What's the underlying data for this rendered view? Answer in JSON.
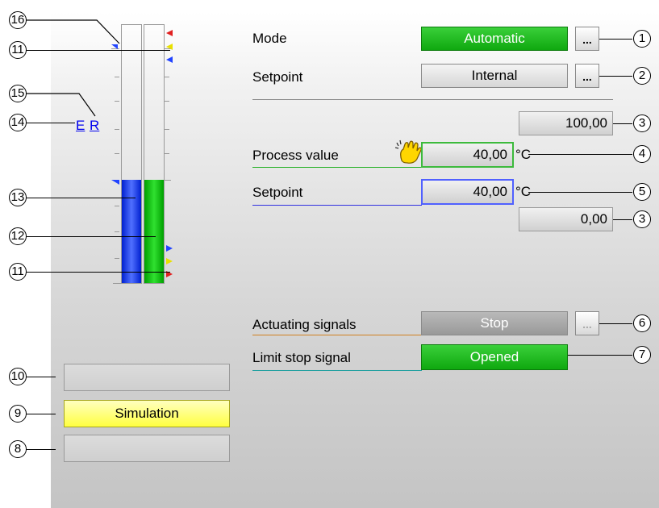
{
  "panel": {
    "mode_label": "Mode",
    "mode_value": "Automatic",
    "mode_more": "...",
    "setpoint_src_label": "Setpoint",
    "setpoint_src_value": "Internal",
    "setpoint_src_more": "...",
    "scale_high": "100,00",
    "process_value_label": "Process value",
    "process_value": "40,00",
    "process_value_unit": "°C",
    "setpoint_label": "Setpoint",
    "setpoint_value": "40,00",
    "setpoint_unit": "°C",
    "scale_low": "0,00",
    "actuating_label": "Actuating signals",
    "actuating_value": "Stop",
    "actuating_more": "...",
    "limit_label": "Limit stop signal",
    "limit_value": "Opened",
    "link_e": "E",
    "link_r": "R",
    "status_top": "",
    "status_sim": "Simulation",
    "status_bottom": ""
  },
  "bars": {
    "setpoint_fraction": 0.4,
    "process_fraction": 0.4
  },
  "callouts": {
    "c1": "1",
    "c2": "2",
    "c3a": "3",
    "c4": "4",
    "c5": "5",
    "c3b": "3",
    "c6": "6",
    "c7": "7",
    "c8": "8",
    "c9": "9",
    "c10": "10",
    "c11a": "11",
    "c11b": "11",
    "c12": "12",
    "c13": "13",
    "c14": "14",
    "c15": "15",
    "c16": "16"
  },
  "colors": {
    "green": "#10a810",
    "blue_bar": "#2233ff",
    "green_bar": "#11cc11",
    "sim_yellow": "#ffff40"
  }
}
